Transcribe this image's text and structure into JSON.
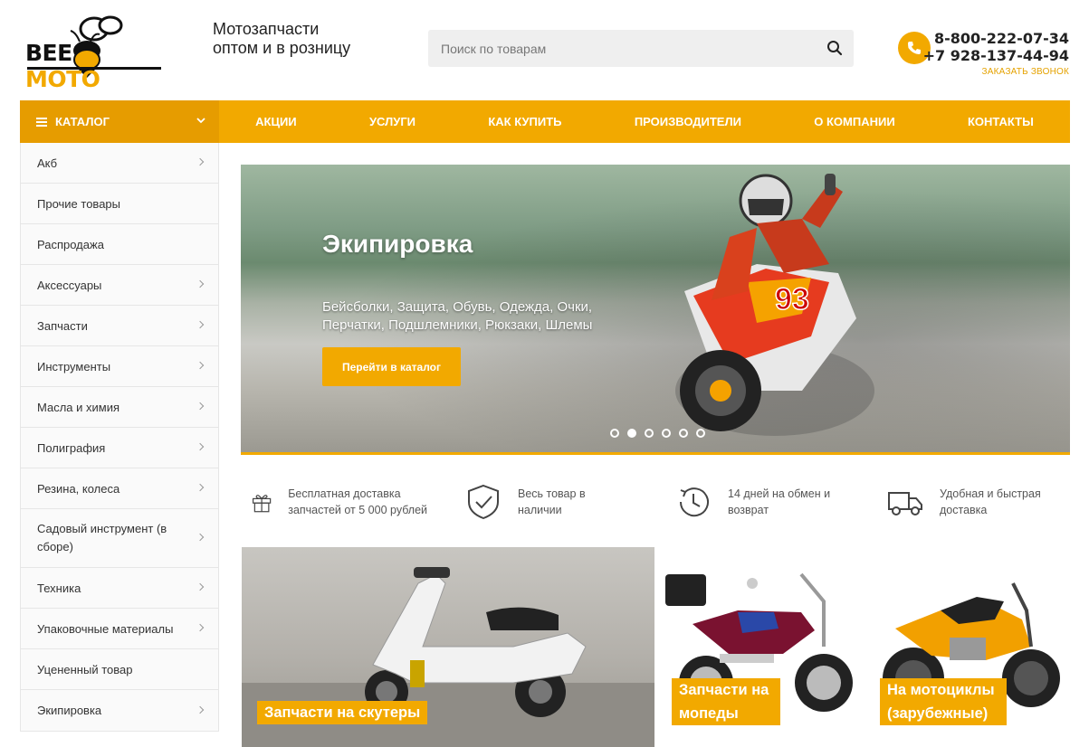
{
  "header": {
    "logo_text_a": "BEE",
    "logo_text_b": "MOTO",
    "tagline_line1": "Мотозапчасти",
    "tagline_line2": "оптом и в розницу",
    "search_placeholder": "Поиск по товарам",
    "phone1": "8-800-222-07-34",
    "phone2": "+7 928-137-44-94",
    "callback": "ЗАКАЗАТЬ ЗВОНОК"
  },
  "nav": {
    "catalog": "КАТАЛОГ",
    "items": [
      "АКЦИИ",
      "УСЛУГИ",
      "КАК КУПИТЬ",
      "ПРОИЗВОДИТЕЛИ",
      "О КОМПАНИИ",
      "КОНТАКТЫ"
    ]
  },
  "sidebar": {
    "items": [
      "Акб",
      "Прочие товары",
      "Распродажа",
      "Аксессуары",
      "Запчасти",
      "Инструменты",
      "Масла и химия",
      "Полиграфия",
      "Резина, колеса",
      "Садовый инструмент (в сборе)",
      "Техника",
      "Упаковочные материалы",
      "Уцененный товар",
      "Экипировка"
    ]
  },
  "hero": {
    "title": "Экипировка",
    "subtitle": "Бейсболки, Защита, Обувь, Одежда, Очки, Перчатки, Подшлемники, Рюкзаки, Шлемы",
    "button": "Перейти в каталог",
    "slide_count": 6,
    "active_slide": 2
  },
  "features": [
    {
      "icon": "gift-icon",
      "text": "Бесплатная доставка запчастей от 5 000 рублей"
    },
    {
      "icon": "shield-check-icon",
      "text": "Весь товар в наличии"
    },
    {
      "icon": "clock-return-icon",
      "text": "14 дней на обмен и возврат"
    },
    {
      "icon": "truck-icon",
      "text": "Удобная и быстрая доставка"
    }
  ],
  "tiles": {
    "scooter": "Запчасти на скутеры",
    "moped": "Запчасти на мопеды",
    "moto": "На мотоциклы (зарубежные)"
  },
  "colors": {
    "accent": "#f2a900",
    "accent_dark": "#e69c00"
  }
}
